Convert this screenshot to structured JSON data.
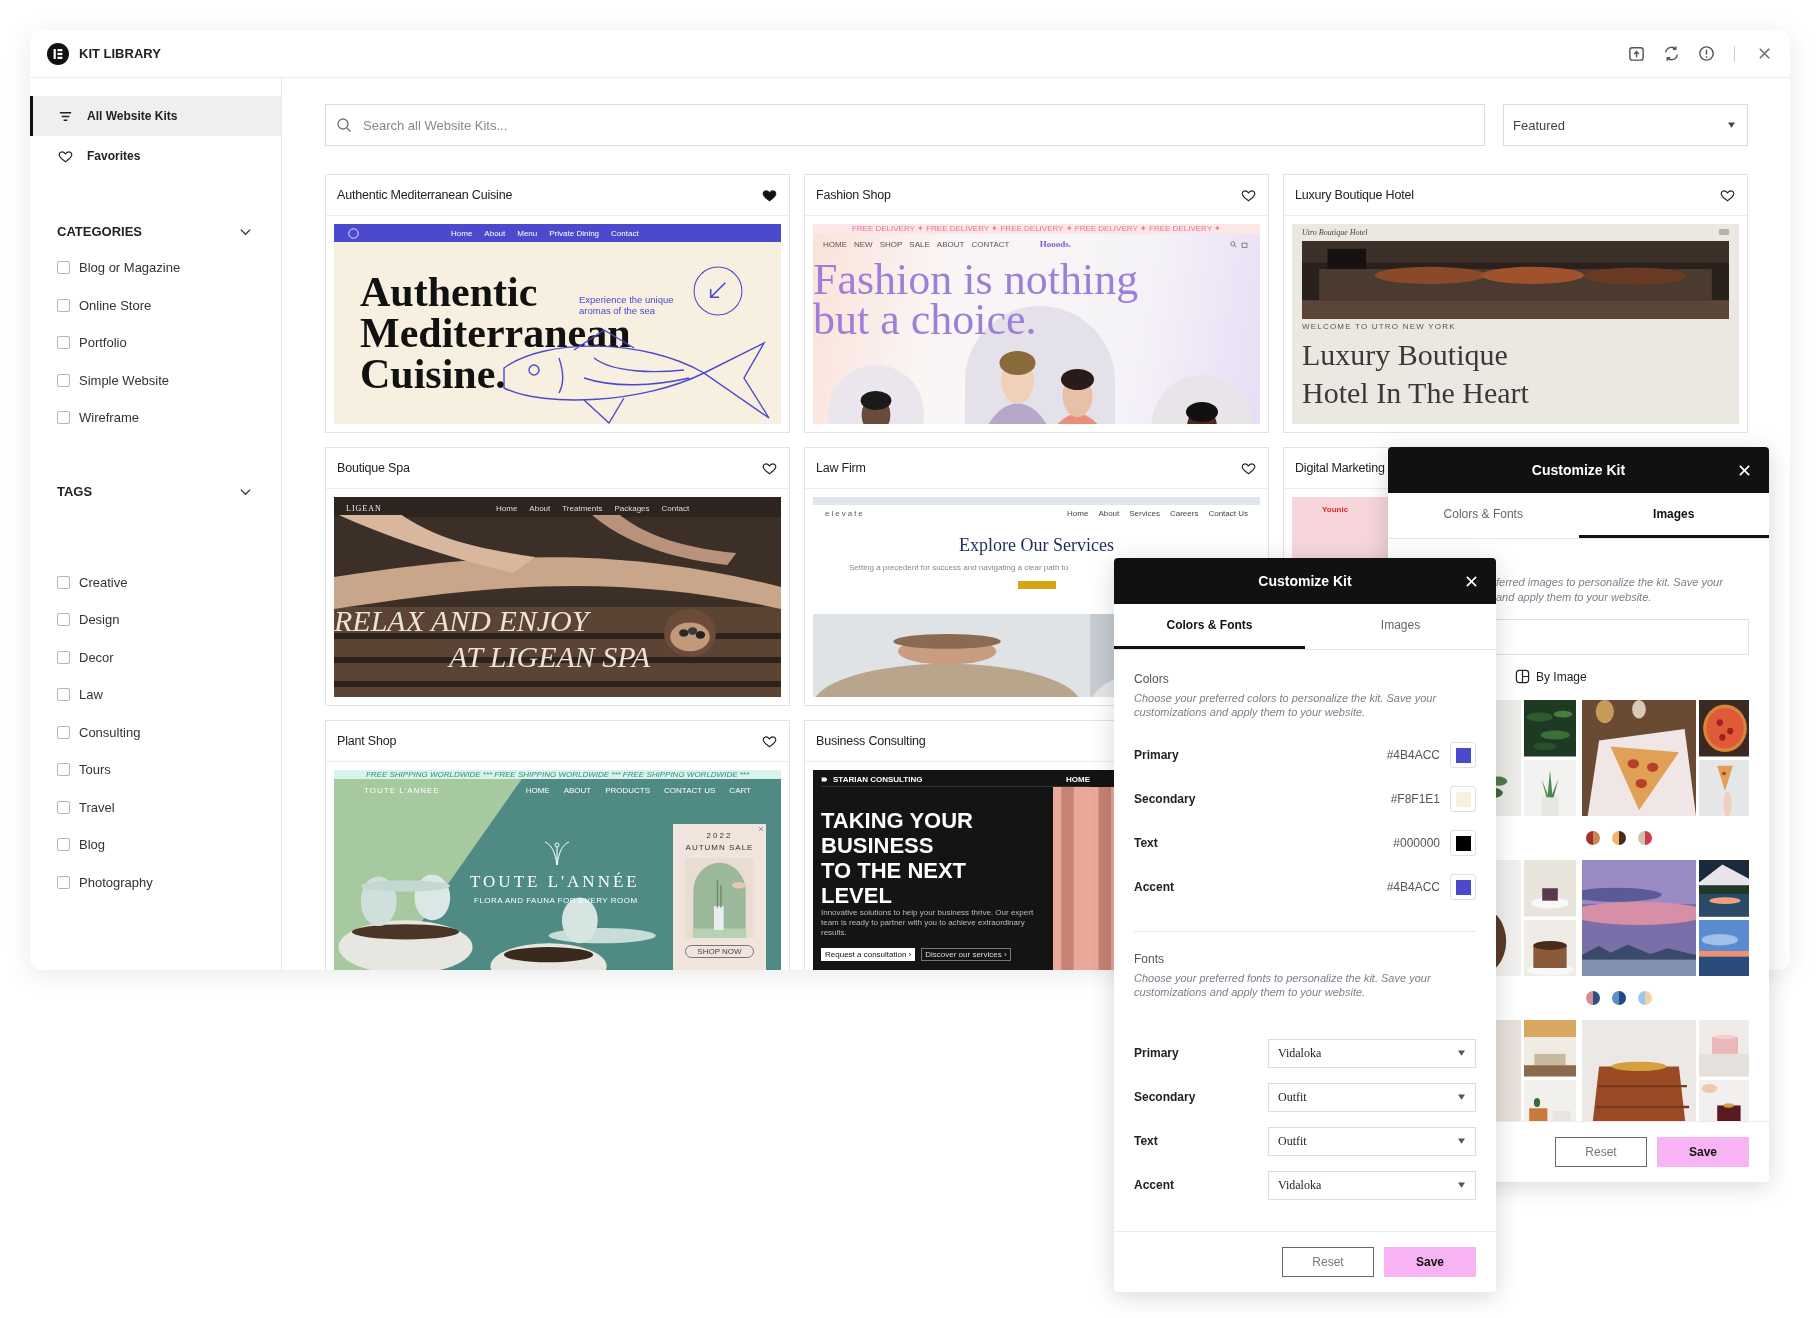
{
  "window": {
    "title": "KIT LIBRARY"
  },
  "sidebar": {
    "nav": [
      {
        "kind": "all",
        "label": "All Website Kits",
        "selected": true
      },
      {
        "kind": "favorites",
        "label": "Favorites",
        "selected": false
      }
    ],
    "sections": [
      {
        "title": "CATEGORIES",
        "expanded": true,
        "items": [
          {
            "label": "Blog or Magazine",
            "checked": false
          },
          {
            "label": "Online Store",
            "checked": false
          },
          {
            "label": "Portfolio",
            "checked": false
          },
          {
            "label": "Simple Website",
            "checked": false
          },
          {
            "label": "Wireframe",
            "checked": false
          }
        ]
      },
      {
        "title": "TAGS",
        "expanded": true,
        "items": [
          {
            "label": "Creative",
            "checked": false
          },
          {
            "label": "Design",
            "checked": false
          },
          {
            "label": "Decor",
            "checked": false
          },
          {
            "label": "Law",
            "checked": false
          },
          {
            "label": "Consulting",
            "checked": false
          },
          {
            "label": "Tours",
            "checked": false
          },
          {
            "label": "Travel",
            "checked": false
          },
          {
            "label": "Blog",
            "checked": false
          },
          {
            "label": "Photography",
            "checked": false
          }
        ]
      }
    ]
  },
  "search": {
    "placeholder": "Search all Website Kits..."
  },
  "sort": {
    "value": "Featured"
  },
  "cards": [
    {
      "title": "Authentic Mediterranean Cuisine",
      "favorite": true,
      "preview": {
        "kind": "restaurant",
        "nav": [
          "Home",
          "About",
          "Menu",
          "Private Dining",
          "Contact"
        ],
        "headline_lines": [
          "Authentic",
          "Mediterranean",
          "Cuisine."
        ],
        "tagline": "Experience the unique aromas of the sea"
      }
    },
    {
      "title": "Fashion Shop",
      "favorite": false,
      "preview": {
        "kind": "fashion",
        "ticker": "FREE DELIVERY ✦ FREE DELIVERY ✦ FREE DELIVERY ✦ FREE DELIVERY ✦ FREE DELIVERY ✦",
        "nav": [
          "HOME",
          "NEW",
          "SHOP",
          "SALE",
          "ABOUT",
          "CONTACT"
        ],
        "logo": "Hooods.",
        "headline_lines": [
          "Fashion is nothing",
          "but a choice."
        ]
      }
    },
    {
      "title": "Luxury Boutique Hotel",
      "favorite": false,
      "preview": {
        "kind": "hotel",
        "logo": "Utro Boutique Hotel",
        "eyebrow": "WELCOME TO UTRO NEW YORK",
        "headline_lines": [
          "Luxury Boutique",
          "Hotel In The Heart"
        ]
      }
    },
    {
      "title": "Boutique Spa",
      "favorite": false,
      "preview": {
        "kind": "spa",
        "logo": "LIGEAN",
        "nav": [
          "Home",
          "About",
          "Treatments",
          "Packages",
          "Contact"
        ],
        "headline_lines": [
          "RELAX AND ENJOY",
          "AT LIGEAN SPA"
        ]
      }
    },
    {
      "title": "Law Firm",
      "favorite": false,
      "preview": {
        "kind": "law",
        "logo": "elevate",
        "nav": [
          "Home",
          "About",
          "Services",
          "Careers",
          "Contact Us"
        ],
        "headline": "Explore Our Services",
        "subline": "Setting a precedent for success and navigating a clear path to"
      }
    },
    {
      "title": "Digital Marketing",
      "preview": {
        "kind": "marketing",
        "logo": "Younic"
      }
    },
    {
      "title": "Plant Shop",
      "favorite": false,
      "preview": {
        "kind": "plant",
        "ticker": "FREE SHIPPING WORLDWIDE *** FREE SHIPPING WORLDWIDE *** FREE SHIPPING WORLDWIDE ***",
        "logo": "TOUTE L'ANNEE",
        "nav": [
          "HOME",
          "ABOUT",
          "PRODUCTS",
          "CONTACT US",
          "CART"
        ],
        "headline": "TOUTE L'ANNÉE",
        "subline": "FLORA AND FAUNA FOR EVERY ROOM",
        "popup_year": "2022",
        "popup_title": "AUTUMN SALE",
        "popup_button": "SHOP NOW"
      }
    },
    {
      "title": "Business Consulting",
      "preview": {
        "kind": "consulting",
        "logo": "STARIAN CONSULTING",
        "nav": [
          "HOME"
        ],
        "headline_lines": [
          "TAKING YOUR",
          "BUSINESS",
          "TO THE NEXT",
          "LEVEL"
        ],
        "body": "Innovative solutions to help your business thrive. Our expert team is ready to partner with you to achieve extraordinary results.",
        "buttons": [
          "Request a consultation ›",
          "Discover our services ›"
        ]
      }
    }
  ],
  "images_panel": {
    "title": "Customize Kit",
    "tabs": [
      {
        "label": "Colors & Fonts",
        "selected": false
      },
      {
        "label": "Images",
        "selected": true
      }
    ],
    "description_lines": [
      "ferred images to personalize the kit. Save your",
      "and apply them to your website."
    ],
    "filter_label": "By Image",
    "image_sets": [
      {
        "kind": "picture"
      },
      {
        "kind": "picture",
        "swatches": [
          {
            "parts": [
              {
                "color": "#a5302a"
              },
              {
                "color": "#c98557"
              }
            ]
          },
          {
            "parts": [
              {
                "color": "#f3b470"
              },
              {
                "color": "#4b2a20"
              }
            ]
          },
          {
            "parts": [
              {
                "color": "#cbc5ad"
              },
              {
                "color": "#d13b4b"
              }
            ]
          }
        ]
      },
      {
        "kind": "picture"
      },
      {
        "kind": "picture",
        "swatches": [
          {
            "parts": [
              {
                "color": "#d98a94"
              },
              {
                "color": "#2e4f86"
              }
            ]
          },
          {
            "parts": [
              {
                "color": "#5d8fc4"
              },
              {
                "color": "#1f4a86"
              }
            ]
          },
          {
            "parts": [
              {
                "color": "#9cc8f0"
              },
              {
                "color": "#f5d2a4"
              }
            ]
          }
        ]
      },
      {
        "kind": "picture"
      },
      {
        "kind": "picture"
      }
    ],
    "reset": "Reset",
    "save": "Save"
  },
  "colors_panel": {
    "title": "Customize Kit",
    "tabs": [
      {
        "label": "Colors & Fonts",
        "selected": true
      },
      {
        "label": "Images",
        "selected": false
      }
    ],
    "colors": {
      "title": "Colors",
      "description": "Choose your preferred colors to personalize the kit. Save your customizations and apply them to your website.",
      "items": [
        {
          "label": "Primary",
          "value": "#4B4ACC",
          "color": "#4b4acc"
        },
        {
          "label": "Secondary",
          "value": "#F8F1E1",
          "color": "#f8f1e1"
        },
        {
          "label": "Text",
          "value": "#000000",
          "color": "#000000"
        },
        {
          "label": "Accent",
          "value": "#4B4ACC",
          "color": "#4b4acc"
        }
      ]
    },
    "fonts": {
      "title": "Fonts",
      "description": "Choose your preferred fonts to personalize the kit. Save your customizations and apply them to your website.",
      "items": [
        {
          "label": "Primary",
          "value": "Vidaloka"
        },
        {
          "label": "Secondary",
          "value": "Outfit"
        },
        {
          "label": "Text",
          "value": "Outfit"
        },
        {
          "label": "Accent",
          "value": "Vidaloka"
        }
      ]
    },
    "reset": "Reset",
    "save": "Save"
  }
}
